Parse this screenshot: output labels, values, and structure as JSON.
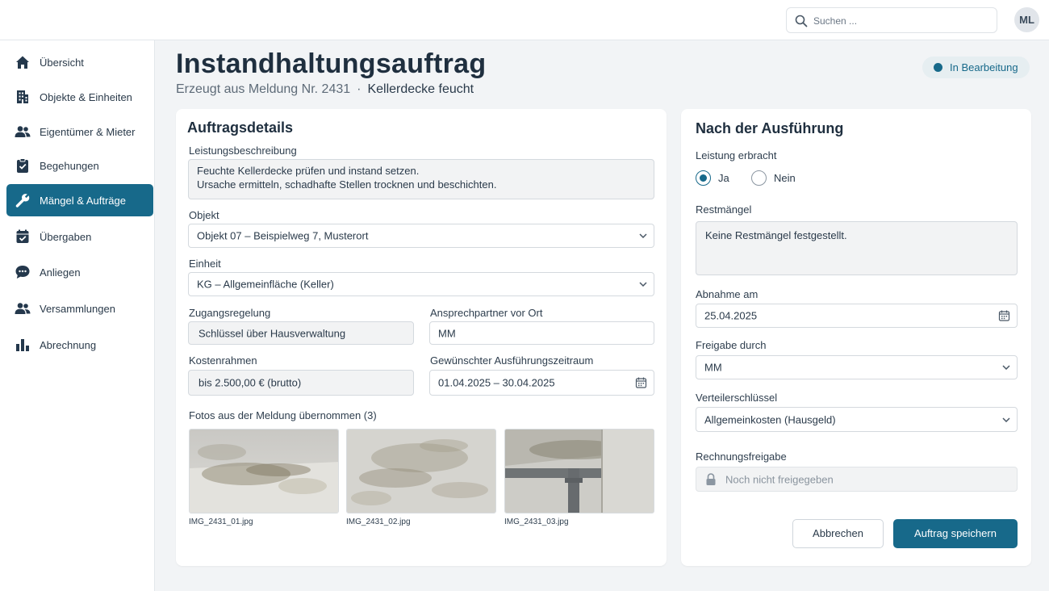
{
  "header": {
    "search_placeholder": "Suchen ...",
    "user_initials": "ML"
  },
  "sidebar": {
    "items": [
      {
        "label": "Übersicht",
        "icon": "home-icon"
      },
      {
        "label": "Objekte & Einheiten",
        "icon": "building-icon"
      },
      {
        "label": "Eigentümer & Mieter",
        "icon": "people-icon"
      },
      {
        "label": "Begehungen",
        "icon": "clipboard-check-icon"
      },
      {
        "label": "Mängel & Aufträge",
        "icon": "wrench-icon",
        "active": true
      },
      {
        "label": "Übergaben",
        "icon": "calendar-check-icon"
      },
      {
        "label": "Anliegen",
        "icon": "chat-bubble-icon"
      },
      {
        "label": "Versammlungen",
        "icon": "group-icon"
      },
      {
        "label": "Abrechnung",
        "icon": "bar-chart-icon"
      }
    ]
  },
  "page": {
    "title": "Instandhaltungsauftrag",
    "subtitle_source": "Erzeugt aus Meldung Nr. 2431",
    "subtitle_separator": "·",
    "subtitle_topic": "Kellerdecke feucht",
    "status": "In Bearbeitung",
    "status_color": "#17698a"
  },
  "details": {
    "title": "Auftragsdetails",
    "description_label": "Leistungsbeschreibung",
    "description_lines": [
      "Feuchte Kellerdecke prüfen und instand setzen.",
      "Ursache ermitteln, schadhafte Stellen trocknen und beschichten."
    ],
    "object_label": "Objekt",
    "object_value": "Objekt 07 – Beispielweg 7, Musterort",
    "unit_label": "Einheit",
    "unit_value": "KG – Allgemeinfläche (Keller)",
    "access_label": "Zugangsregelung",
    "access_value": "Schlüssel über Hausverwaltung",
    "contact_label": "Ansprechpartner vor Ort",
    "contact_value": "MM",
    "cost_label": "Kostenrahmen",
    "cost_value": "bis 2.500,00 € (brutto)",
    "period_label": "Gewünschter Ausführungszeitraum",
    "period_value": "01.04.2025 – 30.04.2025",
    "photos_label": "Fotos aus der Meldung übernommen (3)",
    "photos": [
      "IMG_2431_01.jpg",
      "IMG_2431_02.jpg",
      "IMG_2431_03.jpg"
    ]
  },
  "execution": {
    "title": "Nach der Ausführung",
    "performed_label": "Leistung erbracht",
    "option_yes": "Ja",
    "option_no": "Nein",
    "performed_selected": "Ja",
    "defects_label": "Restmängel",
    "defects_value": "Keine Restmängel festgestellt.",
    "acceptance_label": "Abnahme am",
    "acceptance_value": "25.04.2025",
    "approved_label": "Freigabe durch",
    "approved_value": "MM",
    "key_label": "Verteilerschlüssel",
    "key_value": "Allgemeinkosten (Hausgeld)",
    "invoice_label": "Rechnungsfreigabe",
    "invoice_value": "Noch nicht freigegeben",
    "cancel_label": "Abbrechen",
    "save_label": "Auftrag speichern"
  },
  "colors": {
    "accent": "#17698a",
    "background": "#f2f4f6"
  }
}
